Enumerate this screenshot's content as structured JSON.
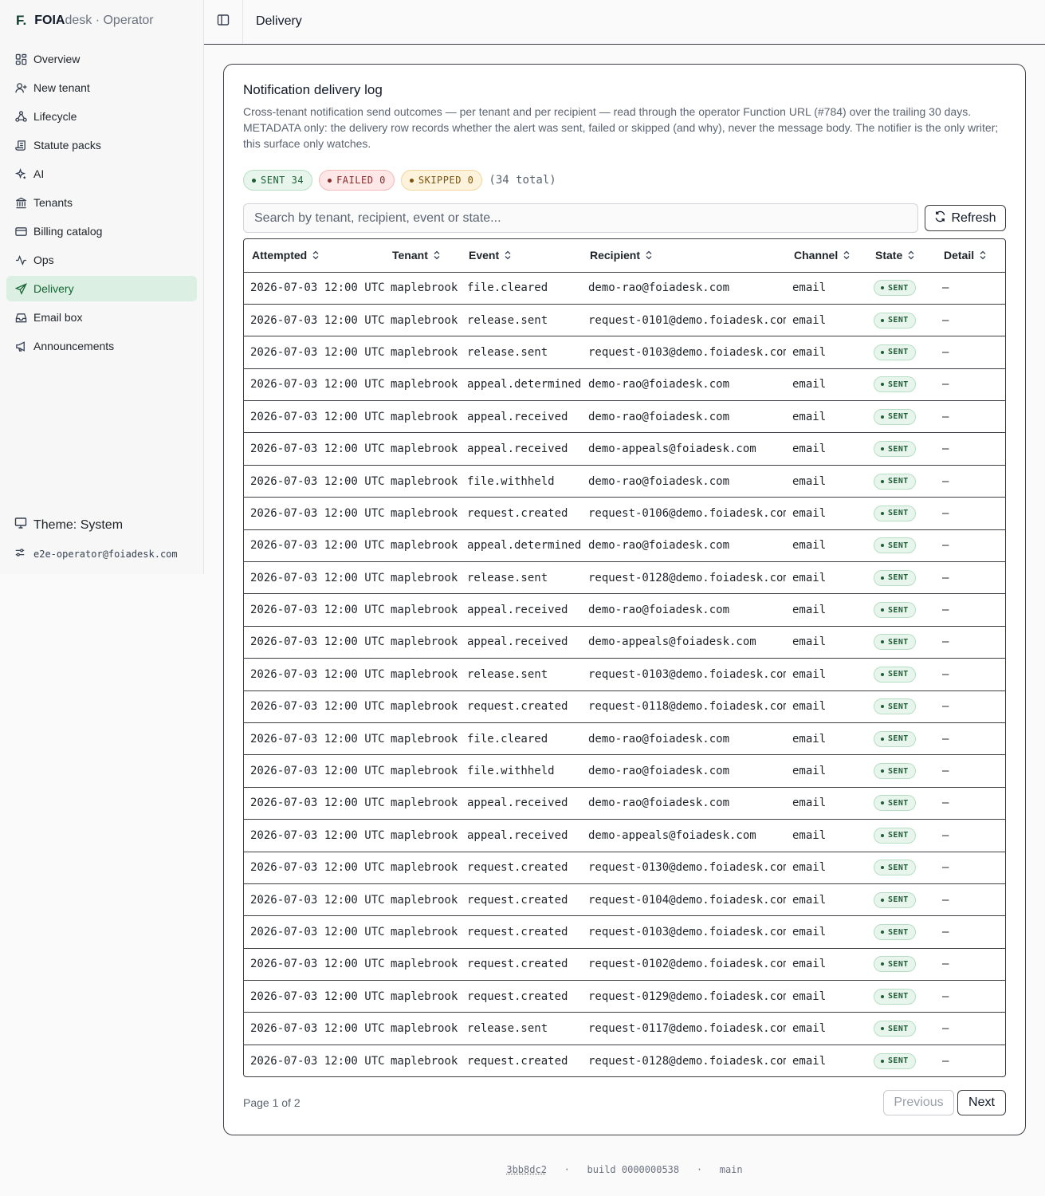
{
  "brand": {
    "mark": "F.",
    "name_bold": "FOIA",
    "name_rest": "desk · Operator"
  },
  "nav": [
    {
      "label": "Overview",
      "icon": "grid-icon",
      "active": false
    },
    {
      "label": "New tenant",
      "icon": "user-plus-icon",
      "active": false
    },
    {
      "label": "Lifecycle",
      "icon": "workflow-icon",
      "active": false
    },
    {
      "label": "Statute packs",
      "icon": "scroll-icon",
      "active": false
    },
    {
      "label": "AI",
      "icon": "sparkles-icon",
      "active": false
    },
    {
      "label": "Tenants",
      "icon": "building-icon",
      "active": false
    },
    {
      "label": "Billing catalog",
      "icon": "credit-card-icon",
      "active": false
    },
    {
      "label": "Ops",
      "icon": "activity-icon",
      "active": false
    },
    {
      "label": "Delivery",
      "icon": "send-icon",
      "active": true
    },
    {
      "label": "Email box",
      "icon": "inbox-icon",
      "active": false
    },
    {
      "label": "Announcements",
      "icon": "megaphone-icon",
      "active": false
    }
  ],
  "theme_label": "Theme: System",
  "user_email": "e2e-operator@foiadesk.com",
  "header": {
    "title": "Delivery"
  },
  "card": {
    "title": "Notification delivery log",
    "description": "Cross-tenant notification send outcomes — per tenant and per recipient — read through the operator Function URL (#784) over the trailing 30 days. METADATA only: the delivery row records whether the alert was sent, failed or skipped (and why), never the message body. The notifier is the only writer; this surface only watches."
  },
  "summary": {
    "sent": "SENT 34",
    "failed": "FAILED 0",
    "skipped": "SKIPPED 0",
    "total": "(34 total)"
  },
  "search": {
    "placeholder": "Search by tenant, recipient, event or state..."
  },
  "refresh_label": "Refresh",
  "table": {
    "columns": [
      "Attempted",
      "Tenant",
      "Event",
      "Recipient",
      "Channel",
      "State",
      "Detail"
    ],
    "rows": [
      [
        "2026-07-03 12:00 UTC",
        "maplebrook",
        "file.cleared",
        "demo-rao@foiadesk.com",
        "email",
        "SENT",
        "—"
      ],
      [
        "2026-07-03 12:00 UTC",
        "maplebrook",
        "release.sent",
        "request-0101@demo.foiadesk.com",
        "email",
        "SENT",
        "—"
      ],
      [
        "2026-07-03 12:00 UTC",
        "maplebrook",
        "release.sent",
        "request-0103@demo.foiadesk.com",
        "email",
        "SENT",
        "—"
      ],
      [
        "2026-07-03 12:00 UTC",
        "maplebrook",
        "appeal.determined",
        "demo-rao@foiadesk.com",
        "email",
        "SENT",
        "—"
      ],
      [
        "2026-07-03 12:00 UTC",
        "maplebrook",
        "appeal.received",
        "demo-rao@foiadesk.com",
        "email",
        "SENT",
        "—"
      ],
      [
        "2026-07-03 12:00 UTC",
        "maplebrook",
        "appeal.received",
        "demo-appeals@foiadesk.com",
        "email",
        "SENT",
        "—"
      ],
      [
        "2026-07-03 12:00 UTC",
        "maplebrook",
        "file.withheld",
        "demo-rao@foiadesk.com",
        "email",
        "SENT",
        "—"
      ],
      [
        "2026-07-03 12:00 UTC",
        "maplebrook",
        "request.created",
        "request-0106@demo.foiadesk.com",
        "email",
        "SENT",
        "—"
      ],
      [
        "2026-07-03 12:00 UTC",
        "maplebrook",
        "appeal.determined",
        "demo-rao@foiadesk.com",
        "email",
        "SENT",
        "—"
      ],
      [
        "2026-07-03 12:00 UTC",
        "maplebrook",
        "release.sent",
        "request-0128@demo.foiadesk.com",
        "email",
        "SENT",
        "—"
      ],
      [
        "2026-07-03 12:00 UTC",
        "maplebrook",
        "appeal.received",
        "demo-rao@foiadesk.com",
        "email",
        "SENT",
        "—"
      ],
      [
        "2026-07-03 12:00 UTC",
        "maplebrook",
        "appeal.received",
        "demo-appeals@foiadesk.com",
        "email",
        "SENT",
        "—"
      ],
      [
        "2026-07-03 12:00 UTC",
        "maplebrook",
        "release.sent",
        "request-0103@demo.foiadesk.com",
        "email",
        "SENT",
        "—"
      ],
      [
        "2026-07-03 12:00 UTC",
        "maplebrook",
        "request.created",
        "request-0118@demo.foiadesk.com",
        "email",
        "SENT",
        "—"
      ],
      [
        "2026-07-03 12:00 UTC",
        "maplebrook",
        "file.cleared",
        "demo-rao@foiadesk.com",
        "email",
        "SENT",
        "—"
      ],
      [
        "2026-07-03 12:00 UTC",
        "maplebrook",
        "file.withheld",
        "demo-rao@foiadesk.com",
        "email",
        "SENT",
        "—"
      ],
      [
        "2026-07-03 12:00 UTC",
        "maplebrook",
        "appeal.received",
        "demo-rao@foiadesk.com",
        "email",
        "SENT",
        "—"
      ],
      [
        "2026-07-03 12:00 UTC",
        "maplebrook",
        "appeal.received",
        "demo-appeals@foiadesk.com",
        "email",
        "SENT",
        "—"
      ],
      [
        "2026-07-03 12:00 UTC",
        "maplebrook",
        "request.created",
        "request-0130@demo.foiadesk.com",
        "email",
        "SENT",
        "—"
      ],
      [
        "2026-07-03 12:00 UTC",
        "maplebrook",
        "request.created",
        "request-0104@demo.foiadesk.com",
        "email",
        "SENT",
        "—"
      ],
      [
        "2026-07-03 12:00 UTC",
        "maplebrook",
        "request.created",
        "request-0103@demo.foiadesk.com",
        "email",
        "SENT",
        "—"
      ],
      [
        "2026-07-03 12:00 UTC",
        "maplebrook",
        "request.created",
        "request-0102@demo.foiadesk.com",
        "email",
        "SENT",
        "—"
      ],
      [
        "2026-07-03 12:00 UTC",
        "maplebrook",
        "request.created",
        "request-0129@demo.foiadesk.com",
        "email",
        "SENT",
        "—"
      ],
      [
        "2026-07-03 12:00 UTC",
        "maplebrook",
        "release.sent",
        "request-0117@demo.foiadesk.com",
        "email",
        "SENT",
        "—"
      ],
      [
        "2026-07-03 12:00 UTC",
        "maplebrook",
        "request.created",
        "request-0128@demo.foiadesk.com",
        "email",
        "SENT",
        "—"
      ]
    ]
  },
  "pagination": {
    "text": "Page 1 of 2",
    "previous": "Previous",
    "next": "Next"
  },
  "footer": {
    "hash": "3bb8dc2",
    "build": "build 0000000538",
    "branch": "main",
    "sep": "·"
  },
  "colors": {
    "accent": "#166534",
    "active_bg": "#dcefe3",
    "sent_bg": "#e8f5ec",
    "failed_bg": "#fde7e7",
    "skipped_bg": "#fdf3dc"
  }
}
